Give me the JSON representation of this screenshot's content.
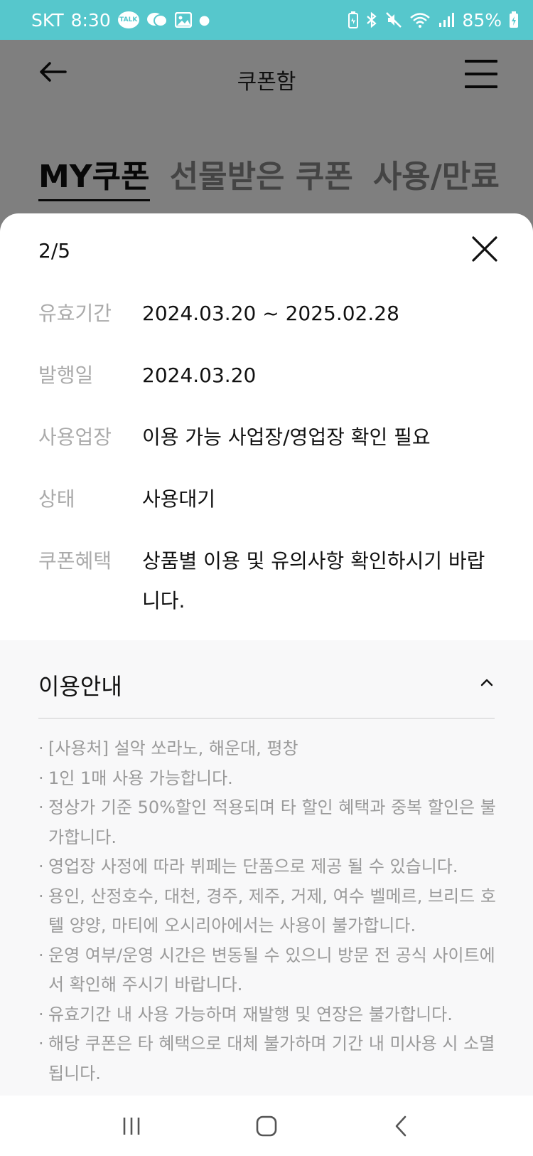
{
  "status_bar": {
    "carrier": "SKT",
    "time": "8:30",
    "talk_label": "TALK",
    "battery": "85%"
  },
  "header": {
    "title": "쿠폰함"
  },
  "tabs": [
    {
      "label": "MY쿠폰",
      "active": true
    },
    {
      "label": "선물받은 쿠폰",
      "active": false
    },
    {
      "label": "사용/만료",
      "active": false
    }
  ],
  "sheet": {
    "pager": "2/5",
    "rows": [
      {
        "label": "유효기간",
        "value": "2024.03.20 ~ 2025.02.28"
      },
      {
        "label": "발행일",
        "value": "2024.03.20"
      },
      {
        "label": "사용업장",
        "value": "이용 가능 사업장/영업장 확인 필요"
      },
      {
        "label": "상태",
        "value": "사용대기"
      },
      {
        "label": "쿠폰혜택",
        "value": "상품별 이용 및 유의사항 확인하시기 바랍니다."
      }
    ],
    "guide": {
      "title": "이용안내",
      "items": [
        "[사용처] 설악 쏘라노, 해운대, 평창",
        "1인 1매 사용 가능합니다.",
        "정상가 기준 50%할인 적용되며 타 할인 혜택과 중복 할인은 불가합니다.",
        "영업장 사정에 따라 뷔페는 단품으로 제공 될 수 있습니다.",
        "용인, 산정호수, 대천, 경주, 제주, 거제, 여수 벨메르, 브리드 호텔 양양, 마티에 오시리아에서는 사용이 불가합니다.",
        "운영 여부/운영 시간은 변동될 수 있으니 방문 전 공식 사이트에서 확인해 주시기 바랍니다.",
        "유효기간 내 사용 가능하며 재발행 및 연장은 불가합니다.",
        "해당 쿠폰은 타 혜택으로 대체 불가하며 기간 내 미사용 시 소멸됩니다."
      ]
    }
  },
  "icons": {
    "back": "arrow-left-icon",
    "menu": "hamburger-icon",
    "close": "close-icon",
    "collapse": "chevron-up-icon"
  },
  "colors": {
    "status_bar": "#56c7cc",
    "label_gray": "#aaaaaa",
    "guide_bg": "#f8f8f9"
  }
}
